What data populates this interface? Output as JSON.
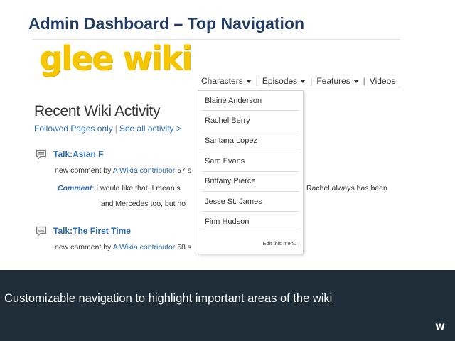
{
  "slide": {
    "title": "Admin Dashboard – Top Navigation",
    "caption": "Customizable navigation to highlight important areas of the wiki",
    "brand_mark": "w"
  },
  "wiki": {
    "logo_text": "glee wiki",
    "nav": [
      {
        "label": "Characters",
        "has_menu": true
      },
      {
        "label": "Episodes",
        "has_menu": true
      },
      {
        "label": "Features",
        "has_menu": true
      },
      {
        "label": "Videos",
        "has_menu": false
      }
    ],
    "separator": "|",
    "dropdown": {
      "items": [
        "Blaine Anderson",
        "Rachel Berry",
        "Santana Lopez",
        "Sam Evans",
        "Brittany Pierce",
        "Jesse St. James",
        "Finn Hudson"
      ],
      "edit_label": "Edit this menu"
    },
    "recent_activity": {
      "title": "Recent Wiki Activity",
      "followed_link": "Followed Pages only",
      "see_all_link": "See all activity >",
      "items": [
        {
          "title": "Talk:Asian F",
          "meta_prefix": "new comment by",
          "contributor": "A Wikia contributor",
          "time": "57 s",
          "comment_label": "Comment",
          "comment_text": ": I would like that, I mean s",
          "comment_right": "Rachel always has been",
          "comment_line2": "and Mercedes too, but no"
        },
        {
          "title": "Talk:The First Time",
          "meta_prefix": "new comment by",
          "contributor": "A Wikia contributor",
          "time": "58 s"
        }
      ]
    }
  },
  "colors": {
    "title": "#1f3b66",
    "logo": "#f6c700",
    "link": "#2a6ab4",
    "banner": "#1f2e38"
  }
}
